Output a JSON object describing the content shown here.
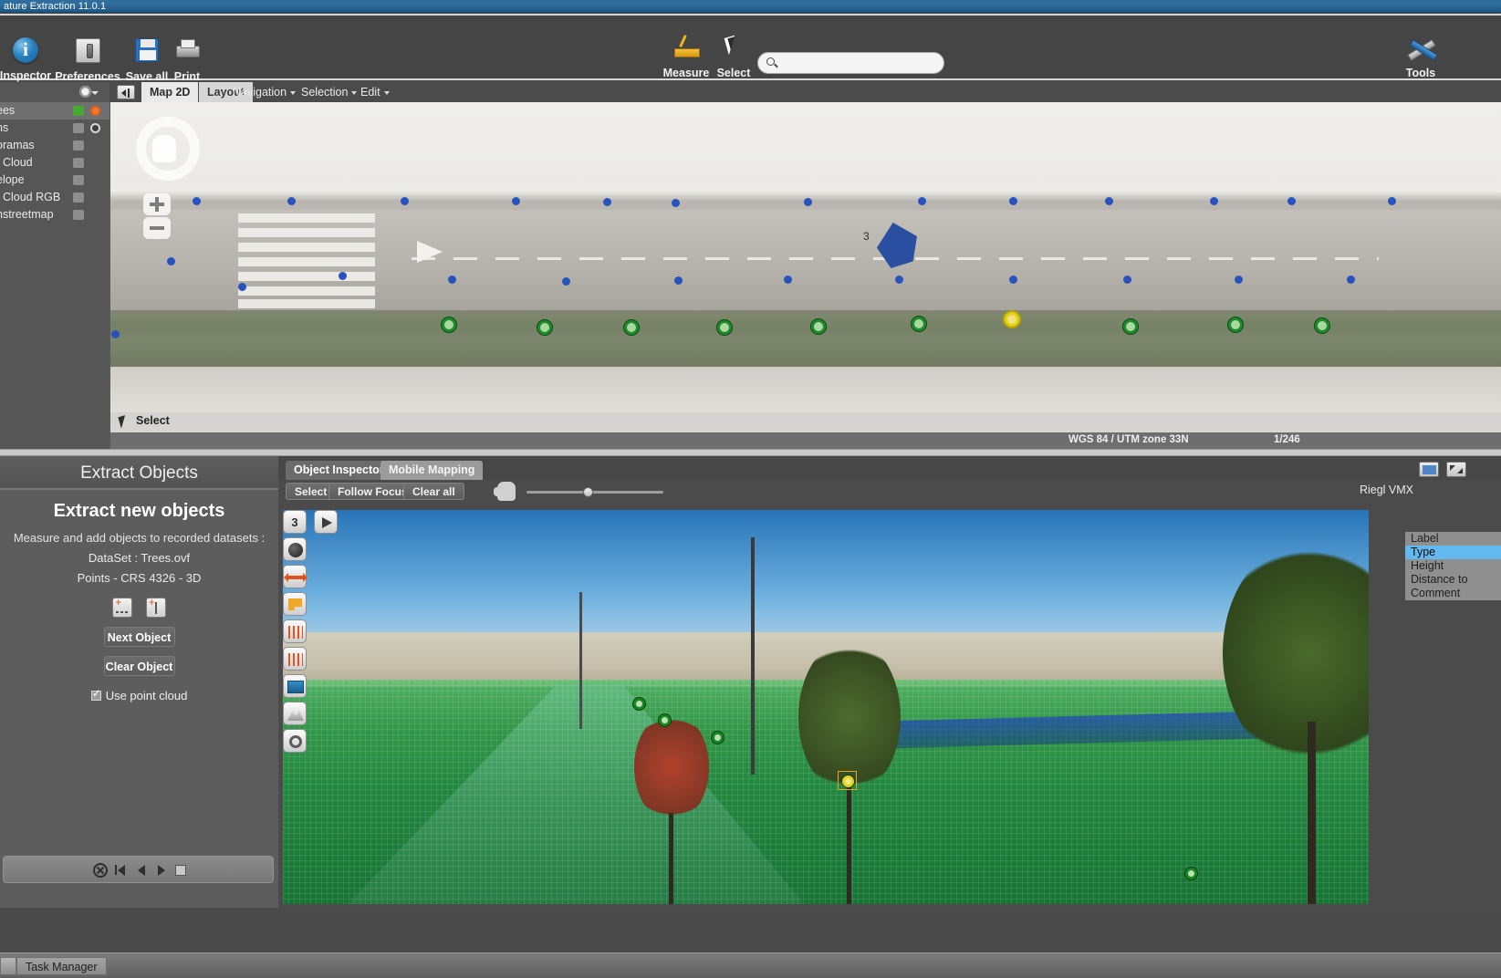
{
  "window": {
    "title": "ature Extraction 11.0.1"
  },
  "toolbar": {
    "items": [
      {
        "label": "Inspector",
        "icon": "info-icon"
      },
      {
        "label": "Preferences",
        "icon": "preferences-icon"
      },
      {
        "label": "Save all",
        "icon": "save-icon"
      },
      {
        "label": "Print",
        "icon": "print-icon"
      },
      {
        "label": "Measure",
        "icon": "ruler-icon"
      },
      {
        "label": "Select",
        "icon": "cursor-icon"
      },
      {
        "label": "Tools",
        "icon": "tools-icon"
      }
    ],
    "search": {
      "value": "",
      "placeholder": ""
    }
  },
  "layers": {
    "items": [
      {
        "label": "ees",
        "selected": true
      },
      {
        "label": "ns",
        "selected": false
      },
      {
        "label": "oramas",
        "selected": false
      },
      {
        "label": "t Cloud",
        "selected": false
      },
      {
        "label": "elope",
        "selected": false
      },
      {
        "label": "t Cloud RGB",
        "selected": false
      },
      {
        "label": "nstreetmap",
        "selected": false
      }
    ]
  },
  "map": {
    "tabs": [
      {
        "label": "Map 2D",
        "active": true
      },
      {
        "label": "Layout",
        "active": false
      }
    ],
    "menus": [
      {
        "label": "Navigation"
      },
      {
        "label": "Selection"
      },
      {
        "label": "Edit"
      }
    ],
    "select_label": "Select",
    "polygon_number": "3",
    "status": {
      "crs": "WGS 84 / UTM zone 33N",
      "counter": "1/246"
    }
  },
  "extract": {
    "header": "Extract Objects",
    "title": "Extract new objects",
    "subtitle": "Measure and add objects to recorded datasets :",
    "dataset": "DataSet : Trees.ovf",
    "crs_line": "Points - CRS 4326 - 3D",
    "next_object": "Next Object",
    "clear_object": "Clear Object",
    "use_point_cloud": "Use point cloud"
  },
  "inspector": {
    "tabs": [
      {
        "label": "Object Inspector",
        "active": true
      },
      {
        "label": "Mobile Mapping",
        "active": false
      }
    ],
    "buttons": [
      {
        "label": "Select"
      },
      {
        "label": "Follow Focus"
      },
      {
        "label": "Clear all"
      }
    ],
    "source_label": "Riegl VMX",
    "frame_number": "3",
    "attributes": [
      {
        "label": "Label",
        "selected": false
      },
      {
        "label": "Type",
        "selected": true
      },
      {
        "label": "Height",
        "selected": false
      },
      {
        "label": "Distance to",
        "selected": false
      },
      {
        "label": "Comment",
        "selected": false
      }
    ]
  },
  "taskbar": {
    "task": "Task Manager"
  }
}
